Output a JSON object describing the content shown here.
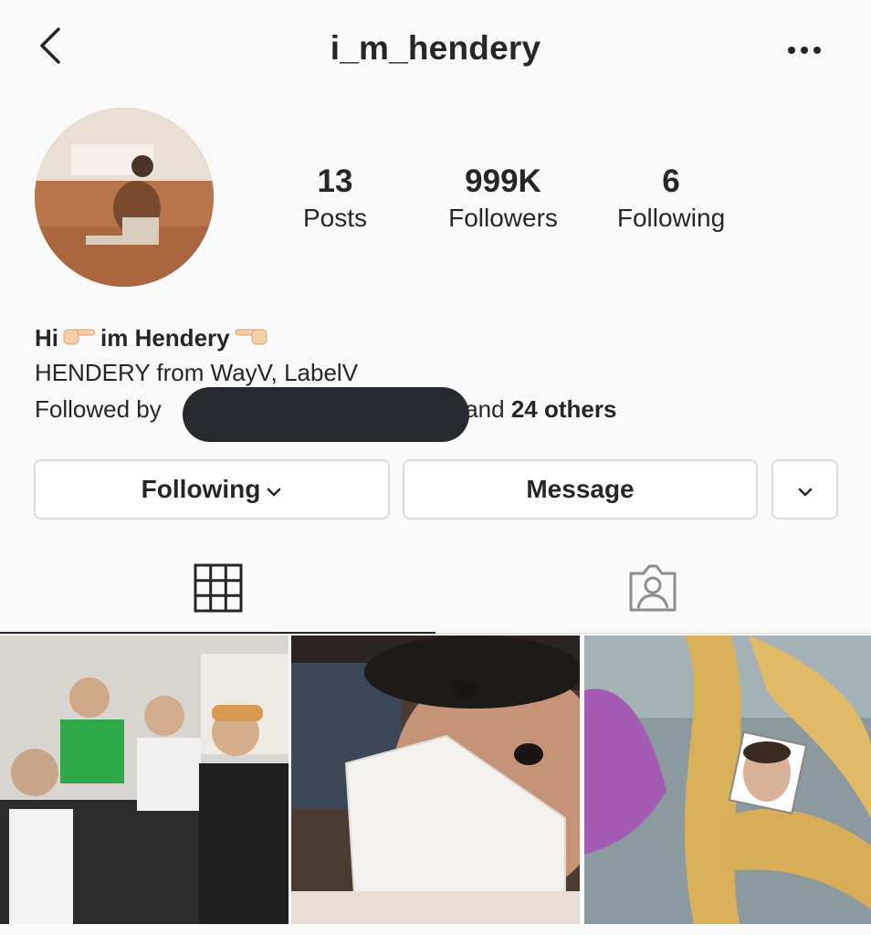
{
  "header": {
    "username": "i_m_hendery",
    "back_icon": "chevron-left-icon",
    "more_icon": "ellipsis-icon"
  },
  "stats": {
    "posts": {
      "value": "13",
      "label": "Posts"
    },
    "followers": {
      "value": "999K",
      "label": "Followers"
    },
    "following": {
      "value": "6",
      "label": "Following"
    }
  },
  "bio": {
    "name_prefix": "Hi",
    "name_middle": "im Hendery",
    "line2": "HENDERY from WayV, LabelV",
    "followed_by_label": "Followed by",
    "followed_and": "and",
    "followed_others": "24 others"
  },
  "actions": {
    "following_label": "Following",
    "message_label": "Message",
    "dropdown_icon": "chevron-down-icon"
  },
  "tabs": {
    "grid_icon": "grid-icon",
    "tagged_icon": "tagged-person-icon",
    "active": "grid"
  },
  "colors": {
    "text": "#262626",
    "border": "#dbdbdb",
    "background": "#fafafa"
  }
}
